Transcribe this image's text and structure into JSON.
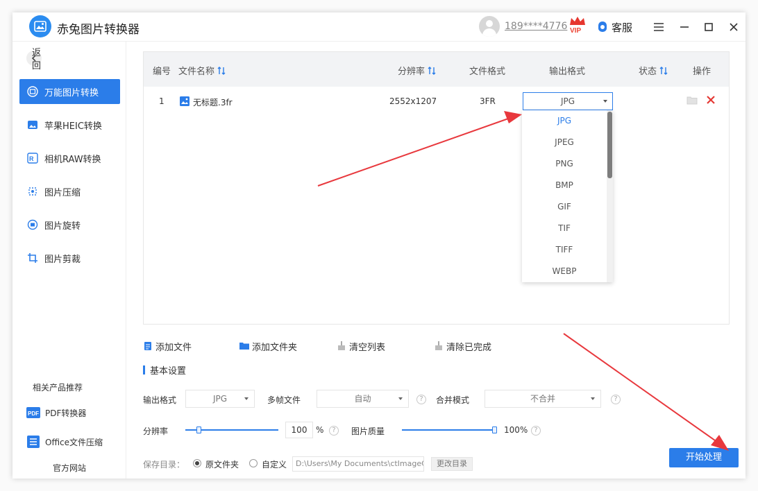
{
  "app": {
    "title": "赤兔图片转换器",
    "user_id": "189****4776",
    "vip_label": "VIP",
    "service_label": "客服"
  },
  "sidebar": {
    "back_label": "返回",
    "items": [
      {
        "label": "万能图片转换",
        "icon": "image-convert-icon",
        "active": true
      },
      {
        "label": "苹果HEIC转换",
        "icon": "heic-icon"
      },
      {
        "label": "相机RAW转换",
        "icon": "raw-icon"
      },
      {
        "label": "图片压缩",
        "icon": "compress-icon"
      },
      {
        "label": "图片旋转",
        "icon": "rotate-icon"
      },
      {
        "label": "图片剪裁",
        "icon": "crop-icon"
      }
    ],
    "related_title": "相关产品推荐",
    "related": [
      {
        "label": "PDF转换器",
        "icon": "pdf-icon",
        "badge": "PDF"
      },
      {
        "label": "Office文件压缩",
        "icon": "office-icon"
      }
    ],
    "official_site": "官方网站"
  },
  "table": {
    "headers": {
      "index": "编号",
      "name": "文件名称",
      "resolution": "分辨率",
      "file_format": "文件格式",
      "output_format": "输出格式",
      "status": "状态",
      "action": "操作"
    },
    "rows": [
      {
        "index": "1",
        "name": "无标题.3fr",
        "resolution": "2552x1207",
        "file_format": "3FR",
        "output_format": "JPG",
        "status": ""
      }
    ]
  },
  "format_dropdown": {
    "selected": "JPG",
    "options": [
      "JPG",
      "JPEG",
      "PNG",
      "BMP",
      "GIF",
      "TIF",
      "TIFF",
      "WEBP"
    ]
  },
  "toolbar": {
    "add_file": "添加文件",
    "add_folder": "添加文件夹",
    "clear_list": "清空列表",
    "clear_done": "清除已完成"
  },
  "settings": {
    "title": "基本设置",
    "output_format_label": "输出格式",
    "output_format_value": "JPG",
    "multiframe_label": "多帧文件",
    "multiframe_value": "自动",
    "merge_label": "合并模式",
    "merge_value": "不合并",
    "resolution_label": "分辨率",
    "resolution_value": "100",
    "resolution_unit": "%",
    "resolution_fraction": 0.15,
    "quality_label": "图片质量",
    "quality_value": "100%",
    "quality_fraction": 1.0,
    "help_glyph": "?"
  },
  "save": {
    "label": "保存目录：",
    "option_original": "原文件夹",
    "option_custom": "自定义",
    "path": "D:\\Users\\My Documents\\ctImageC",
    "change_dir": "更改目录"
  },
  "start_button": "开始处理",
  "colors": {
    "accent": "#2b7de9",
    "danger": "#e53935",
    "annotation_arrow": "#e8383d"
  }
}
